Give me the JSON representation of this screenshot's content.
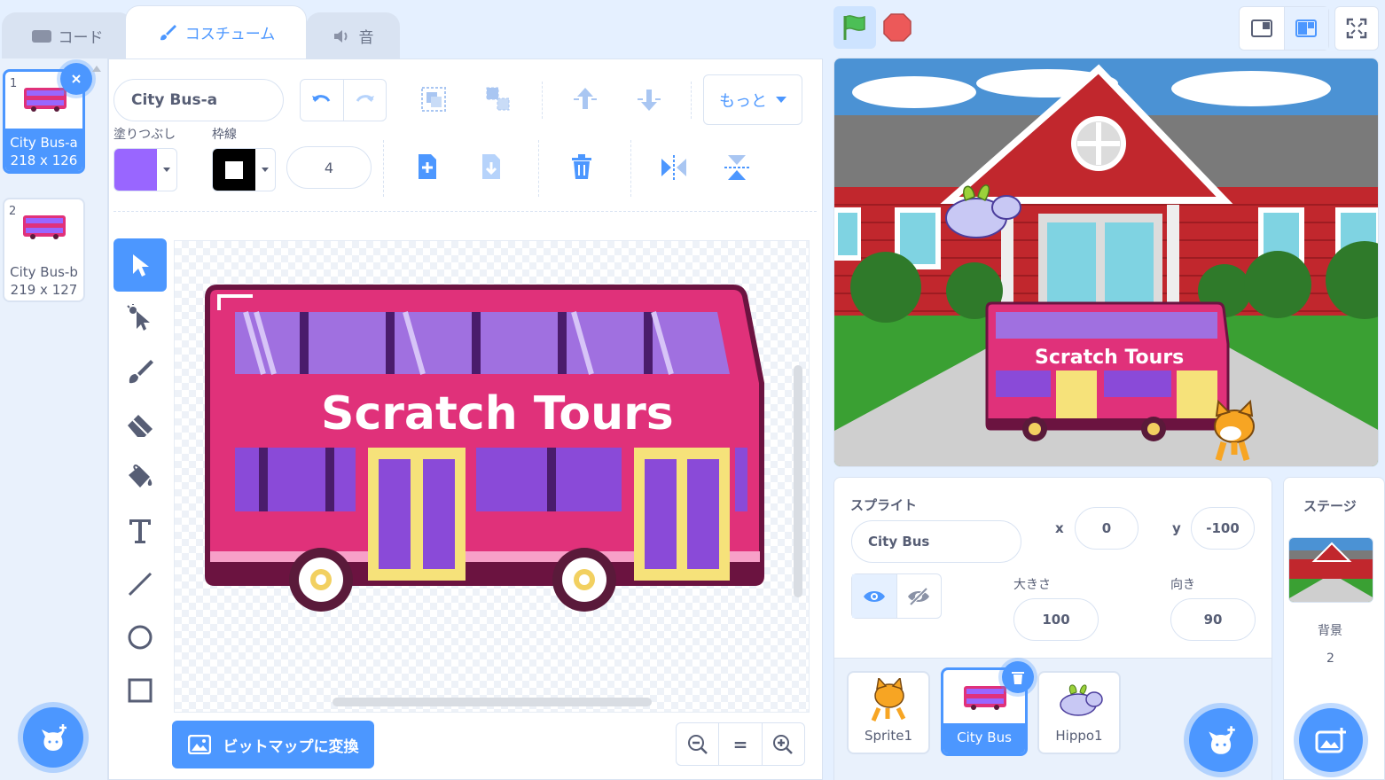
{
  "tabs": [
    {
      "label": "コード"
    },
    {
      "label": "コスチューム"
    },
    {
      "label": "音"
    }
  ],
  "costumes": [
    {
      "number": "1",
      "name": "City Bus-a",
      "size": "218 x 126",
      "selected": true
    },
    {
      "number": "2",
      "name": "City Bus-b",
      "size": "219 x 127",
      "selected": false
    }
  ],
  "editor": {
    "costume_name": "City Bus-a",
    "fill_label": "塗りつぶし",
    "fill_color": "#9966ff",
    "outline_label": "枠線",
    "outline_color": "#000000",
    "outline_width": "4",
    "more_label": "もっと",
    "convert_button": "ビットマップに変換",
    "zoom_reset": "="
  },
  "canvas": {
    "bus_text": "Scratch Tours"
  },
  "sprite": {
    "header": "スプライト",
    "name": "City Bus",
    "x_label": "x",
    "x": "0",
    "y_label": "y",
    "y": "-100",
    "size_label": "大きさ",
    "size": "100",
    "direction_label": "向き",
    "direction": "90"
  },
  "sprites": [
    {
      "name": "Sprite1"
    },
    {
      "name": "City Bus"
    },
    {
      "name": "Hippo1"
    }
  ],
  "stage_panel": {
    "title": "ステージ",
    "backdrop_label": "背景",
    "backdrop_count": "2"
  },
  "colors": {
    "accent": "#4c97ff",
    "stop": "#ec5959",
    "go": "#4cbf56"
  }
}
